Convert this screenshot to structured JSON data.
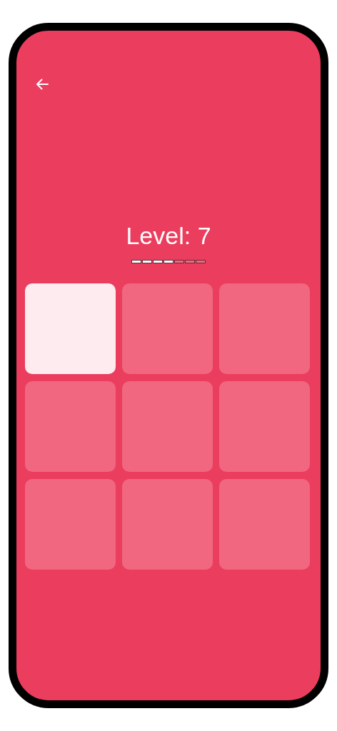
{
  "title": "Level: 7",
  "progress": [
    {
      "on": true
    },
    {
      "on": true
    },
    {
      "on": true
    },
    {
      "on": true
    },
    {
      "on": false
    },
    {
      "on": false
    },
    {
      "on": false
    }
  ],
  "tiles": [
    {
      "lit": true
    },
    {
      "lit": false
    },
    {
      "lit": false
    },
    {
      "lit": false
    },
    {
      "lit": false
    },
    {
      "lit": false
    },
    {
      "lit": false
    },
    {
      "lit": false
    },
    {
      "lit": false
    }
  ]
}
